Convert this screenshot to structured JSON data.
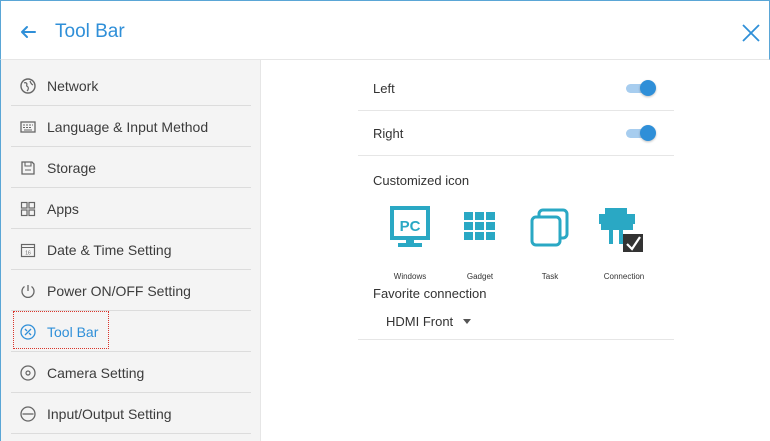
{
  "header": {
    "title": "Tool Bar"
  },
  "sidebar": {
    "items": [
      {
        "label": "Network",
        "icon": "globe-icon"
      },
      {
        "label": "Language & Input Method",
        "icon": "keyboard-icon"
      },
      {
        "label": "Storage",
        "icon": "storage-icon"
      },
      {
        "label": "Apps",
        "icon": "apps-grid-icon"
      },
      {
        "label": "Date & Time Setting",
        "icon": "calendar-icon"
      },
      {
        "label": "Power ON/OFF Setting",
        "icon": "power-icon"
      },
      {
        "label": "Tool Bar",
        "icon": "toolbar-icon"
      },
      {
        "label": "Camera Setting",
        "icon": "camera-icon"
      },
      {
        "label": "Input/Output Setting",
        "icon": "input-output-icon"
      }
    ],
    "active_index": 6
  },
  "main": {
    "left_label": "Left",
    "left_enabled": true,
    "right_label": "Right",
    "right_enabled": true,
    "customized_label": "Customized icon",
    "icons": [
      {
        "caption": "Windows",
        "icon": "pc-monitor-icon"
      },
      {
        "caption": "Gadget",
        "icon": "gadget-grid-icon"
      },
      {
        "caption": "Task",
        "icon": "task-windows-icon"
      },
      {
        "caption": "Connection",
        "icon": "connection-icon"
      }
    ],
    "pc_badge": "PC",
    "favorite_label": "Favorite connection",
    "favorite_value": "HDMI Front"
  },
  "colors": {
    "accent": "#2f8fd8",
    "highlight_outline": "#d9342b",
    "toggle_track": "#a7cdef"
  }
}
